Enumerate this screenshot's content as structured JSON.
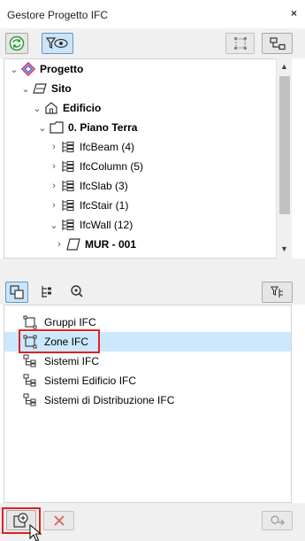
{
  "window": {
    "title": "Gestore Progetto IFC",
    "close_glyph": "×"
  },
  "toolbar_top": {
    "buttons": [
      {
        "icon": "refresh-icon"
      },
      {
        "icon": "filter-view-icon",
        "active": true
      },
      {
        "icon": "select-elements-icon"
      },
      {
        "icon": "structure-icon"
      }
    ]
  },
  "tree": {
    "items": [
      {
        "label": "Progetto",
        "icon": "project-icon",
        "expanded": true
      },
      {
        "label": "Sito",
        "icon": "site-icon",
        "expanded": true
      },
      {
        "label": "Edificio",
        "icon": "building-icon",
        "expanded": true
      },
      {
        "label": "0. Piano Terra",
        "icon": "storey-icon",
        "expanded": true
      },
      {
        "label": "IfcBeam (4)",
        "icon": "ifc-type-icon",
        "expanded": false
      },
      {
        "label": "IfcColumn (5)",
        "icon": "ifc-type-icon",
        "expanded": false
      },
      {
        "label": "IfcSlab (3)",
        "icon": "ifc-type-icon",
        "expanded": false
      },
      {
        "label": "IfcStair (1)",
        "icon": "ifc-type-icon",
        "expanded": false
      },
      {
        "label": "IfcWall (12)",
        "icon": "ifc-type-icon",
        "expanded": true
      },
      {
        "label": "MUR - 001",
        "icon": "wall-element-icon",
        "expanded": false
      }
    ]
  },
  "toolbar_mid": {
    "buttons": [
      {
        "icon": "groups-icon",
        "active": true
      },
      {
        "icon": "hierarchy-icon"
      },
      {
        "icon": "zoom-icon"
      },
      {
        "icon": "tree-settings-icon"
      }
    ]
  },
  "groups_list": {
    "items": [
      {
        "label": "Gruppi IFC",
        "icon": "group-icon"
      },
      {
        "label": "Zone IFC",
        "icon": "zone-icon",
        "selected": true
      },
      {
        "label": "Sistemi IFC",
        "icon": "system-icon"
      },
      {
        "label": "Sistemi Edificio IFC",
        "icon": "system-icon"
      },
      {
        "label": "Sistemi di Distribuzione IFC",
        "icon": "system-icon"
      }
    ]
  },
  "toolbar_bottom": {
    "buttons": [
      {
        "icon": "new-group-icon"
      },
      {
        "icon": "delete-icon",
        "disabled": true
      },
      {
        "icon": "assign-icon",
        "disabled": true
      }
    ]
  },
  "colors": {
    "panel": "#f0f0f0",
    "selection": "#cce8ff",
    "highlight_box": "#e02020",
    "active_button": "#cce4f7",
    "refresh_green": "#2e9b3a",
    "delete_red": "#e06060"
  }
}
